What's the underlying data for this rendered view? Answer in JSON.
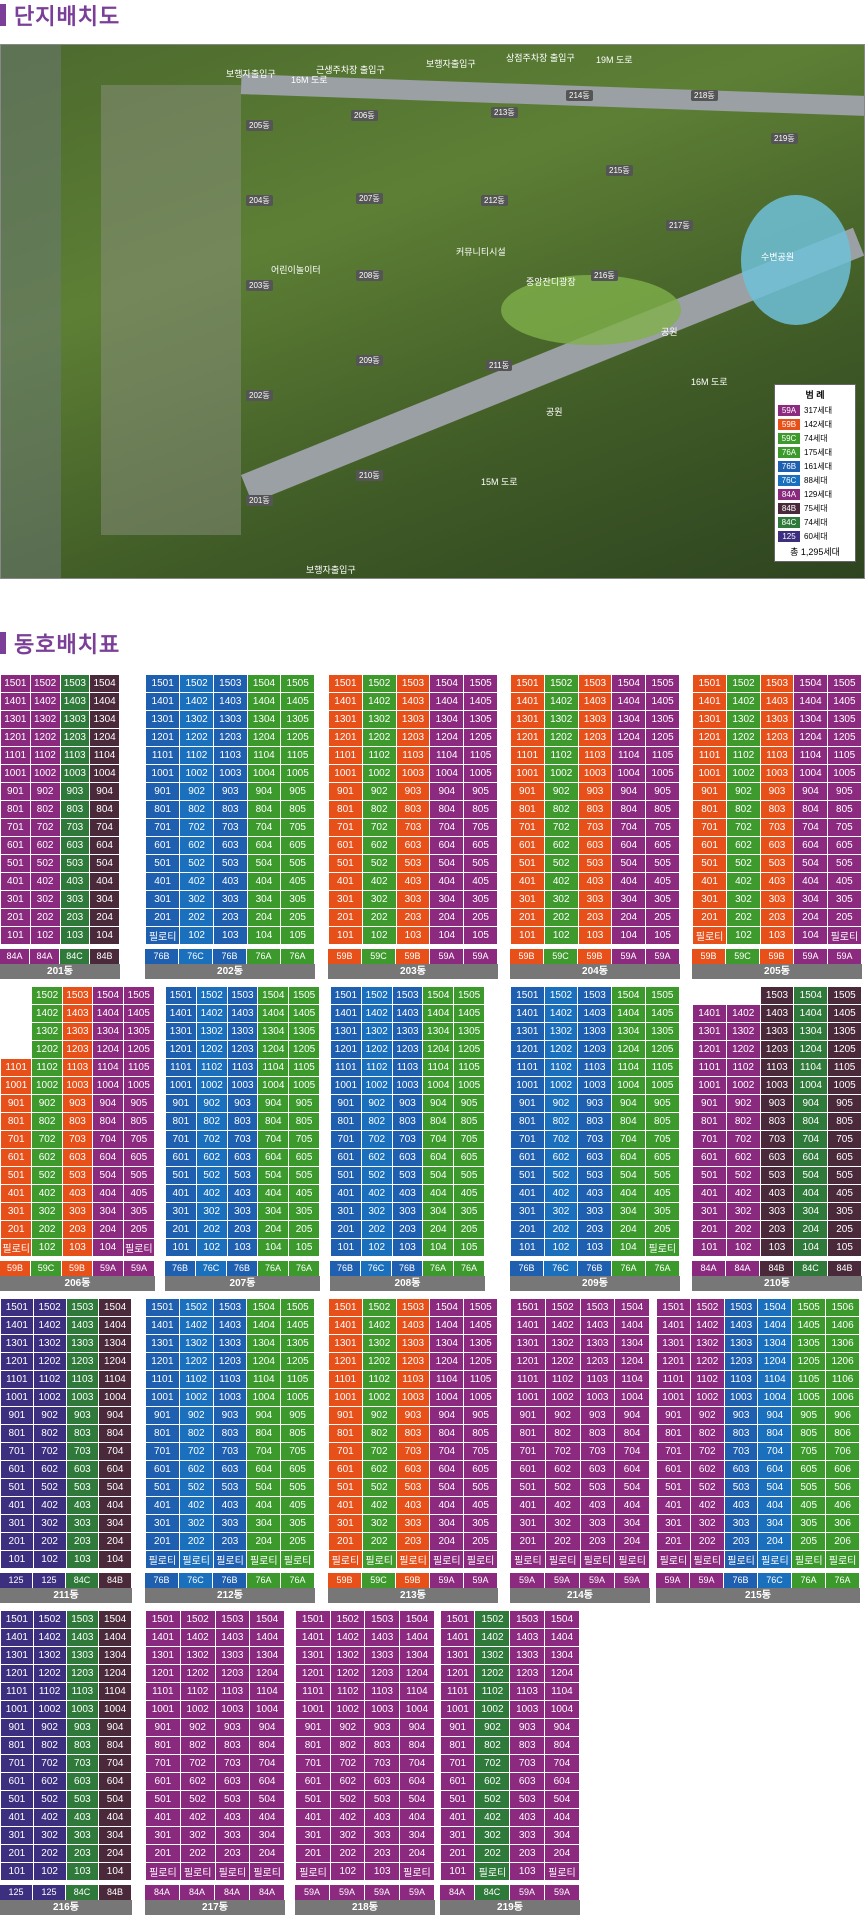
{
  "map_section": {
    "title": "단지배치도"
  },
  "table_section": {
    "title": "동호배치표"
  },
  "colors": {
    "59A": "#8b2a7f",
    "59B": "#e8501a",
    "59C": "#3f9a2e",
    "76A": "#3c9a2c",
    "76B": "#1f5fb0",
    "76C": "#1a70bd",
    "84A": "#8a2a7f",
    "84B": "#4a2a3a",
    "84C": "#2f7a3a",
    "125": "#3d2f80"
  },
  "legend": {
    "title": "범 례",
    "items": [
      {
        "type": "59A",
        "count": "317세대"
      },
      {
        "type": "59B",
        "count": "142세대"
      },
      {
        "type": "59C",
        "count": "74세대"
      },
      {
        "type": "76A",
        "count": "175세대"
      },
      {
        "type": "76B",
        "count": "161세대"
      },
      {
        "type": "76C",
        "count": "88세대"
      },
      {
        "type": "84A",
        "count": "129세대"
      },
      {
        "type": "84B",
        "count": "75세대"
      },
      {
        "type": "84C",
        "count": "74세대"
      },
      {
        "type": "125",
        "count": "60세대"
      }
    ],
    "total": "총 1,295세대"
  },
  "map_labels": {
    "gate1": "보행자출입구",
    "gate2": "근생주차장 출입구",
    "gate3": "보행자출입구",
    "gate4": "상점주차장 출입구",
    "road1": "19M 도로",
    "road2": "16M 도로",
    "road3": "15M 도로",
    "road4": "16M 도로",
    "gate5": "보행자출입구",
    "park1": "수변공원",
    "park2": "공원",
    "park3": "공원",
    "plaza": "중앙잔디광장",
    "fac1": "커뮤니티시설",
    "fac2": "어린이놀이터",
    "buildings": [
      "201동",
      "202동",
      "203동",
      "204동",
      "205동",
      "206동",
      "207동",
      "208동",
      "209동",
      "210동",
      "211동",
      "212동",
      "213동",
      "214동",
      "215동",
      "216동",
      "217동",
      "218동",
      "219동"
    ]
  },
  "buildings": [
    {
      "name": "201동",
      "floors": 15,
      "cols": [
        [
          "84A",
          []
        ],
        [
          "84A",
          []
        ],
        [
          "84C",
          []
        ],
        [
          "84B",
          []
        ]
      ],
      "types": [
        "84A",
        "84A",
        "84C",
        "84B"
      ],
      "special": {}
    },
    {
      "name": "202동",
      "floors": 15,
      "cols": [
        [
          "76B",
          []
        ],
        [
          "76C",
          []
        ],
        [
          "76B",
          []
        ],
        [
          "76A",
          []
        ],
        [
          "76A",
          []
        ]
      ],
      "types": [
        "76B",
        "76C",
        "76B",
        "76A",
        "76A"
      ],
      "special": {
        "1-1": "필로티"
      }
    },
    {
      "name": "203동",
      "floors": 15,
      "cols": [
        [
          "59B",
          []
        ],
        [
          "59C",
          []
        ],
        [
          "59B",
          []
        ],
        [
          "59A",
          []
        ],
        [
          "59A",
          []
        ]
      ],
      "types": [
        "59B",
        "59C",
        "59B",
        "59A",
        "59A"
      ],
      "special": {}
    },
    {
      "name": "204동",
      "floors": 15,
      "cols": [
        [
          "59B",
          []
        ],
        [
          "59C",
          []
        ],
        [
          "59B",
          []
        ],
        [
          "59A",
          []
        ],
        [
          "59A",
          []
        ]
      ],
      "types": [
        "59B",
        "59C",
        "59B",
        "59A",
        "59A"
      ],
      "special": {}
    },
    {
      "name": "205동",
      "floors": 15,
      "cols": [
        [
          "59B",
          []
        ],
        [
          "59C",
          []
        ],
        [
          "59B",
          []
        ],
        [
          "59A",
          []
        ],
        [
          "59A",
          []
        ]
      ],
      "types": [
        "59B",
        "59C",
        "59B",
        "59A",
        "59A"
      ],
      "special": {
        "1-1": "필로티",
        "1-5": "필로티"
      }
    },
    {
      "name": "206동",
      "floors": 15,
      "cols": [
        [
          "59B",
          []
        ],
        [
          "59C",
          []
        ],
        [
          "59B",
          []
        ],
        [
          "59A",
          []
        ],
        [
          "59A",
          []
        ]
      ],
      "types": [
        "59B",
        "59C",
        "59B",
        "59A",
        "59A"
      ],
      "special": {
        "1-1": "필로티",
        "1-5": "필로티"
      },
      "start": [
        11,
        15,
        15,
        15,
        15
      ]
    },
    {
      "name": "207동",
      "floors": 15,
      "cols": [
        [
          "76B",
          []
        ],
        [
          "76C",
          []
        ],
        [
          "76B",
          []
        ],
        [
          "76A",
          []
        ],
        [
          "76A",
          []
        ]
      ],
      "types": [
        "76B",
        "76C",
        "76B",
        "76A",
        "76A"
      ],
      "special": {}
    },
    {
      "name": "208동",
      "floors": 15,
      "cols": [
        [
          "76B",
          []
        ],
        [
          "76C",
          []
        ],
        [
          "76B",
          []
        ],
        [
          "76A",
          []
        ],
        [
          "76A",
          []
        ]
      ],
      "types": [
        "76B",
        "76C",
        "76B",
        "76A",
        "76A"
      ],
      "special": {}
    },
    {
      "name": "209동",
      "floors": 15,
      "cols": [
        [
          "76B",
          []
        ],
        [
          "76C",
          []
        ],
        [
          "76B",
          []
        ],
        [
          "76A",
          []
        ],
        [
          "76A",
          []
        ]
      ],
      "types": [
        "76B",
        "76C",
        "76B",
        "76A",
        "76A"
      ],
      "special": {
        "1-5": "필로티"
      }
    },
    {
      "name": "210동",
      "floors": 15,
      "cols": [
        [
          "84A",
          []
        ],
        [
          "84A",
          []
        ],
        [
          "84B",
          []
        ],
        [
          "84C",
          []
        ],
        [
          "84B",
          []
        ]
      ],
      "types": [
        "84A",
        "84A",
        "84B",
        "84C",
        "84B"
      ],
      "special": {},
      "start": [
        14,
        14,
        15,
        15,
        15
      ]
    },
    {
      "name": "211동",
      "floors": 15,
      "cols": [
        [
          "125",
          []
        ],
        [
          "125",
          []
        ],
        [
          "84C",
          []
        ],
        [
          "84B",
          []
        ]
      ],
      "types": [
        "125",
        "125",
        "84C",
        "84B"
      ],
      "special": {}
    },
    {
      "name": "212동",
      "floors": 15,
      "cols": [
        [
          "76B",
          []
        ],
        [
          "76C",
          []
        ],
        [
          "76B",
          []
        ],
        [
          "76A",
          []
        ],
        [
          "76A",
          []
        ]
      ],
      "types": [
        "76B",
        "76C",
        "76B",
        "76A",
        "76A"
      ],
      "special": {
        "1-1": "필로티",
        "1-2": "필로티",
        "1-3": "필로티",
        "1-4": "필로티",
        "1-5": "필로티"
      }
    },
    {
      "name": "213동",
      "floors": 15,
      "cols": [
        [
          "59B",
          []
        ],
        [
          "59C",
          []
        ],
        [
          "59B",
          []
        ],
        [
          "59A",
          []
        ],
        [
          "59A",
          []
        ]
      ],
      "types": [
        "59B",
        "59C",
        "59B",
        "59A",
        "59A"
      ],
      "special": {
        "1-1": "필로티",
        "1-2": "필로티",
        "1-3": "필로티",
        "1-4": "필로티",
        "1-5": "필로티"
      }
    },
    {
      "name": "214동",
      "floors": 15,
      "cols": [
        [
          "59A",
          []
        ],
        [
          "59A",
          []
        ],
        [
          "59A",
          []
        ],
        [
          "59A",
          []
        ]
      ],
      "types": [
        "59A",
        "59A",
        "59A",
        "59A"
      ],
      "special": {
        "1-1": "필로티",
        "1-2": "필로티",
        "1-3": "필로티",
        "1-4": "필로티"
      }
    },
    {
      "name": "215동",
      "floors": 15,
      "cols": [
        [
          "59A",
          []
        ],
        [
          "59A",
          []
        ],
        [
          "76B",
          []
        ],
        [
          "76C",
          []
        ],
        [
          "76A",
          []
        ],
        [
          "76A",
          []
        ]
      ],
      "types": [
        "59A",
        "59A",
        "76B",
        "76C",
        "76A",
        "76A"
      ],
      "special": {
        "1-1": "필로티",
        "1-2": "필로티",
        "1-3": "필로티",
        "1-4": "필로티",
        "1-5": "필로티",
        "1-6": "필로티"
      }
    },
    {
      "name": "216동",
      "floors": 15,
      "cols": [
        [
          "125",
          []
        ],
        [
          "125",
          []
        ],
        [
          "84C",
          []
        ],
        [
          "84B",
          []
        ]
      ],
      "types": [
        "125",
        "125",
        "84C",
        "84B"
      ],
      "special": {}
    },
    {
      "name": "217동",
      "floors": 15,
      "cols": [
        [
          "84A",
          []
        ],
        [
          "84A",
          []
        ],
        [
          "84A",
          []
        ],
        [
          "84A",
          []
        ]
      ],
      "types": [
        "84A",
        "84A",
        "84A",
        "84A"
      ],
      "special": {
        "1-1": "필로티",
        "1-2": "필로티",
        "1-3": "필로티",
        "1-4": "필로티"
      }
    },
    {
      "name": "218동",
      "floors": 15,
      "cols": [
        [
          "59A",
          []
        ],
        [
          "59A",
          []
        ],
        [
          "59A",
          []
        ],
        [
          "59A",
          []
        ]
      ],
      "types": [
        "59A",
        "59A",
        "59A",
        "59A"
      ],
      "special": {
        "1-1": "필로티",
        "1-4": "필로티"
      }
    },
    {
      "name": "219동",
      "floors": 15,
      "cols": [
        [
          "84A",
          []
        ],
        [
          "84C",
          []
        ],
        [
          "59A",
          []
        ],
        [
          "59A",
          []
        ]
      ],
      "types": [
        "84A",
        "84C",
        "59A",
        "59A"
      ],
      "special": {
        "1-2": "필로티",
        "1-4": "필로티"
      }
    }
  ]
}
